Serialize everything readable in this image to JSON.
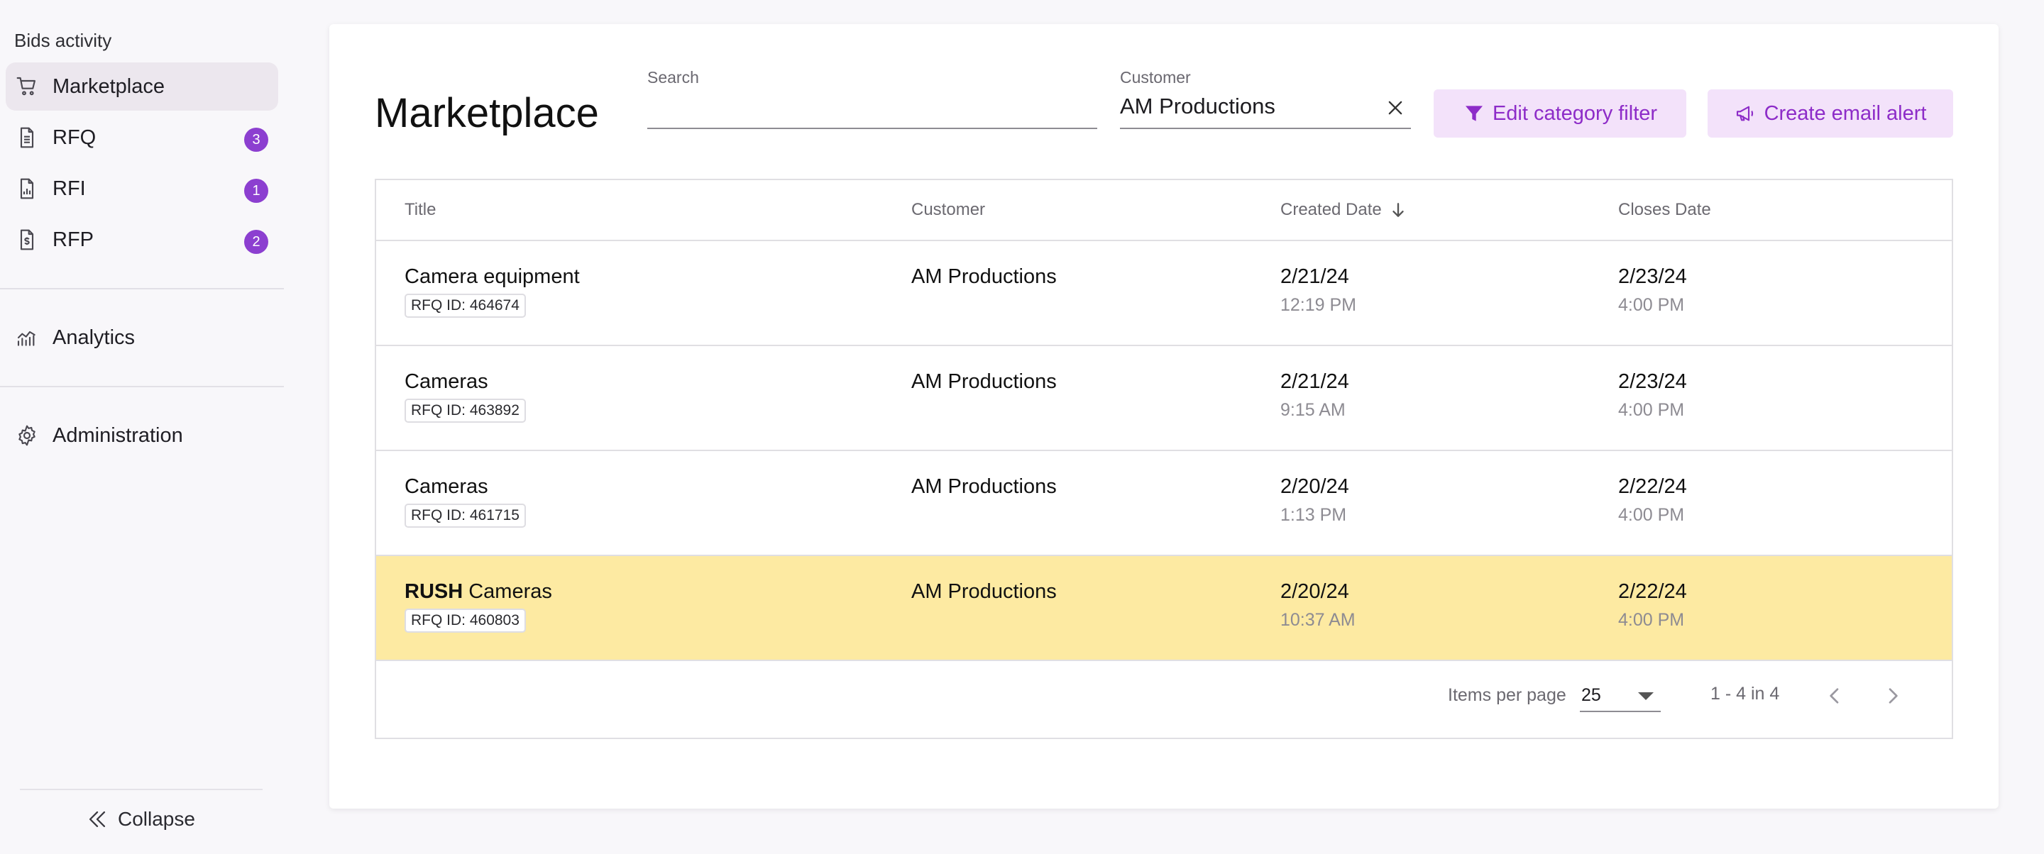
{
  "sidebar": {
    "heading": "Bids activity",
    "items": [
      {
        "label": "Marketplace",
        "icon": "cart-icon"
      },
      {
        "label": "RFQ",
        "icon": "document-icon",
        "badge": "3"
      },
      {
        "label": "RFI",
        "icon": "document-chart-icon",
        "badge": "1"
      },
      {
        "label": "RFP",
        "icon": "document-dollar-icon",
        "badge": "2"
      },
      {
        "label": "Analytics",
        "icon": "analytics-icon"
      },
      {
        "label": "Administration",
        "icon": "gear-icon"
      }
    ],
    "collapse_label": "Collapse"
  },
  "main": {
    "title": "Marketplace",
    "search": {
      "label": "Search",
      "value": "",
      "placeholder": ""
    },
    "customer": {
      "label": "Customer",
      "value": "AM Productions"
    },
    "buttons": {
      "edit_category": "Edit category filter",
      "create_alert": "Create email alert"
    },
    "table": {
      "columns": {
        "title": "Title",
        "customer": "Customer",
        "created": "Created Date",
        "closes": "Closes Date"
      },
      "rows": [
        {
          "prefix": "",
          "title": "Camera equipment",
          "id_label": "RFQ ID: 464674",
          "customer": "AM Productions",
          "created_date": "2/21/24",
          "created_time": "12:19 PM",
          "closes_date": "2/23/24",
          "closes_time": "4:00 PM"
        },
        {
          "prefix": "",
          "title": "Cameras",
          "id_label": "RFQ ID: 463892",
          "customer": "AM Productions",
          "created_date": "2/21/24",
          "created_time": "9:15 AM",
          "closes_date": "2/23/24",
          "closes_time": "4:00 PM"
        },
        {
          "prefix": "",
          "title": "Cameras",
          "id_label": "RFQ ID: 461715",
          "customer": "AM Productions",
          "created_date": "2/20/24",
          "created_time": "1:13 PM",
          "closes_date": "2/22/24",
          "closes_time": "4:00 PM"
        },
        {
          "prefix": "RUSH",
          "title": " Cameras",
          "id_label": "RFQ ID: 460803",
          "customer": "AM Productions",
          "created_date": "2/20/24",
          "created_time": "10:37 AM",
          "closes_date": "2/22/24",
          "closes_time": "4:00 PM"
        }
      ]
    },
    "pager": {
      "items_per_page_label": "Items per page",
      "items_per_page": "25",
      "range": "1 - 4 in 4"
    }
  },
  "colors": {
    "accent": "#8d2cc8",
    "badge": "#8c3fd0",
    "button_bg": "#f3e2fa",
    "rush_row": "#fdeaa2",
    "active_nav": "#ece7ee"
  }
}
